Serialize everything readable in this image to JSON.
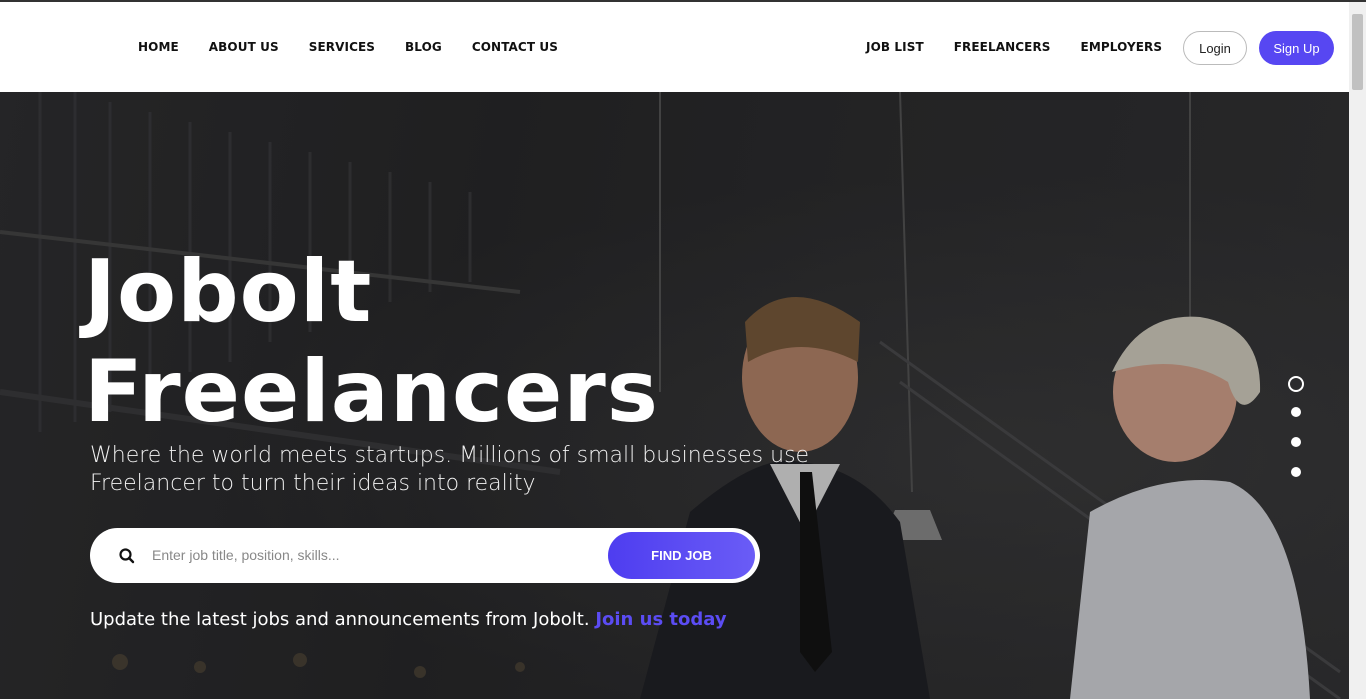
{
  "nav_left": [
    {
      "label": "HOME"
    },
    {
      "label": "ABOUT US"
    },
    {
      "label": "SERVICES"
    },
    {
      "label": "BLOG"
    },
    {
      "label": "CONTACT US"
    }
  ],
  "nav_right": [
    {
      "label": "JOB LIST"
    },
    {
      "label": "FREELANCERS"
    },
    {
      "label": "EMPLOYERS"
    }
  ],
  "auth": {
    "login_label": "Login",
    "signup_label": "Sign Up"
  },
  "hero": {
    "title_line1": "Jobolt",
    "title_line2": "Freelancers",
    "subtitle": "Where the world meets startups. Millions of small businesses use Freelancer to turn their ideas into reality",
    "search_placeholder": "Enter job title, position, skills...",
    "search_value": "",
    "find_button": "FIND JOB",
    "update_text": "Update the latest jobs and announcements from Jobolt.",
    "join_link": "Join us today"
  },
  "slider": {
    "count": 4,
    "active_index": 0
  },
  "colors": {
    "accent": "#5747f2",
    "hero_bg": "#2b2b2d"
  },
  "icons": {
    "search": "search-icon"
  }
}
